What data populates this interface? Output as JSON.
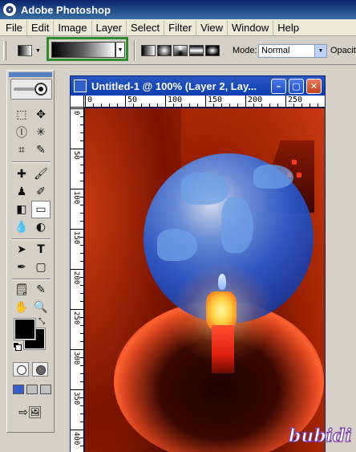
{
  "app": {
    "title": "Adobe Photoshop",
    "icon": "photoshop-app-icon"
  },
  "menu": [
    "File",
    "Edit",
    "Image",
    "Layer",
    "Select",
    "Filter",
    "View",
    "Window",
    "Help"
  ],
  "options": {
    "mode_label": "Mode:",
    "mode_value": "Normal",
    "opacity_label": "Opacity",
    "gradient_preset": "black-to-white",
    "highlight_color": "#2e8b2e"
  },
  "document": {
    "title": "Untitled-1 @ 100% (Layer 2, Lay...",
    "ruler_top": [
      "0",
      "50",
      "100",
      "150",
      "200",
      "250"
    ],
    "ruler_left": [
      "0",
      "50",
      "100",
      "150",
      "200",
      "250",
      "300",
      "350",
      "400"
    ]
  },
  "colors": {
    "foreground": "#000000",
    "background": "#000000",
    "titlebar": "#0a246a"
  },
  "watermark": "bubidi"
}
